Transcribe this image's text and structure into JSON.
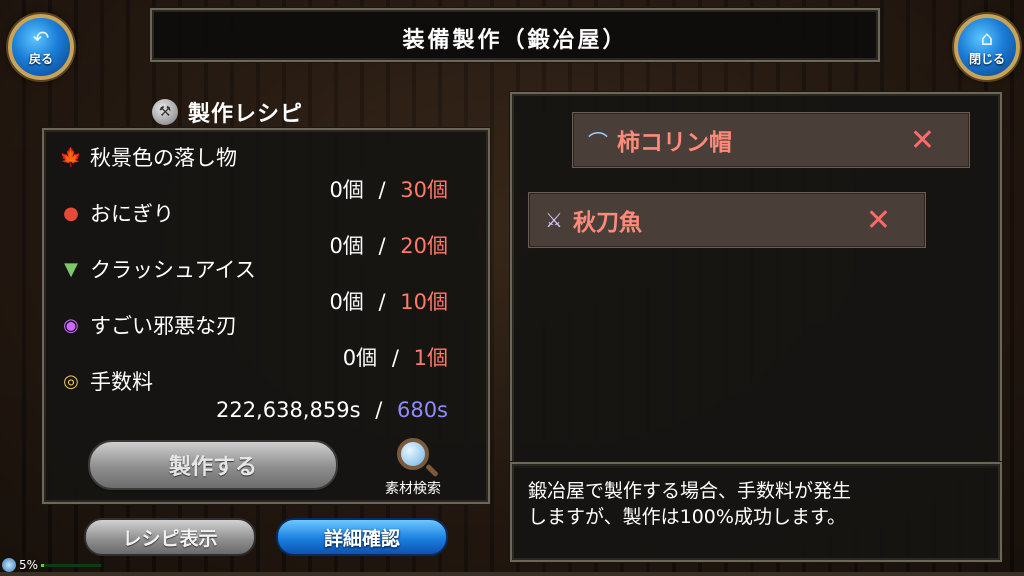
{
  "header": {
    "title": "装備製作（鍛冶屋）",
    "back_label": "戻る",
    "close_label": "閉じる"
  },
  "recipe": {
    "heading": "製作レシピ",
    "materials": [
      {
        "icon": "maple-leaf-icon",
        "name": "秋景色の落し物",
        "have": "0個",
        "sep": "/",
        "need": "30個"
      },
      {
        "icon": "rice-ball-icon",
        "name": "おにぎり",
        "have": "0個",
        "sep": "/",
        "need": "20個"
      },
      {
        "icon": "shaved-ice-icon",
        "name": "クラッシュアイス",
        "have": "0個",
        "sep": "/",
        "need": "10個"
      },
      {
        "icon": "dark-orb-icon",
        "name": "すごい邪悪な刃",
        "have": "0個",
        "sep": "/",
        "need": "1個"
      },
      {
        "icon": "coin-icon",
        "name": "手数料",
        "have": "222,638,859s",
        "sep": "/",
        "need": "680s"
      }
    ],
    "craft_button": "製作する",
    "search_label": "素材検索"
  },
  "footer_buttons": {
    "recipe_display": "レシピ表示",
    "detail_confirm": "詳細確認"
  },
  "slots": [
    {
      "icon": "hat-icon",
      "name": "柿コリン帽"
    },
    {
      "icon": "sword-icon",
      "name": "秋刀魚"
    }
  ],
  "message": {
    "line1": "鍛冶屋で製作する場合、手数料が発生",
    "line2": "しますが、製作は100%成功します。"
  },
  "status": {
    "percent": "5%",
    "level": 0.05
  },
  "colors": {
    "required": "#ff7a6a",
    "fee": "#8f8bff",
    "slot_text": "#ff8a7a"
  }
}
